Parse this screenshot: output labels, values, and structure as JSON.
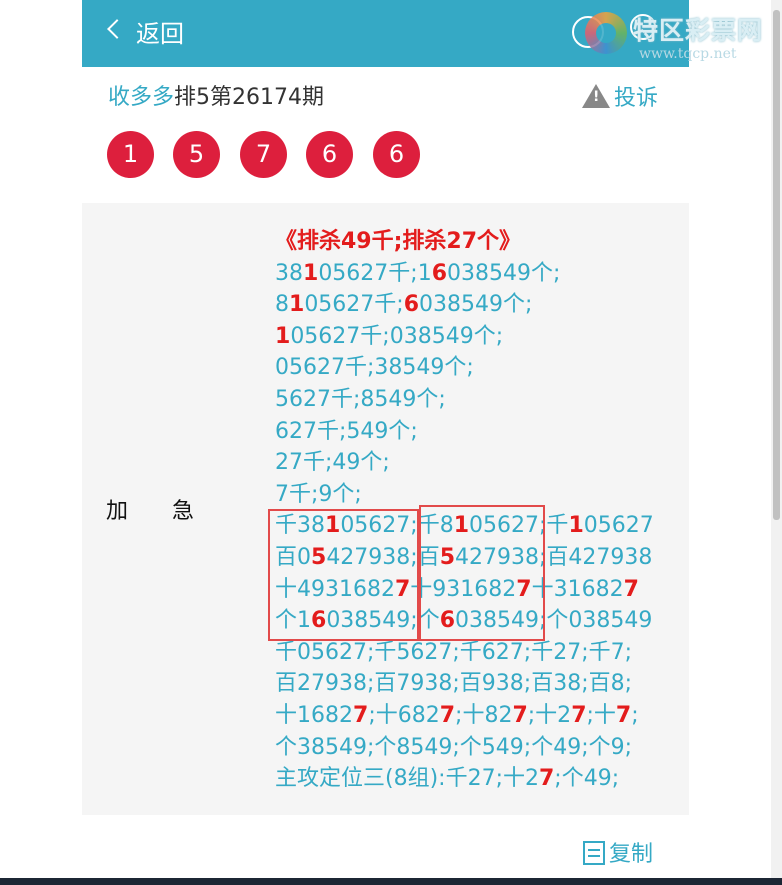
{
  "header": {
    "back_label": "返回",
    "watermark_title": "特区彩票网",
    "watermark_url": "www.tqcp.net",
    "background": "#35a9c5"
  },
  "issue": {
    "site_name": "收多多",
    "title": "排5第26174期",
    "complain_label": "投诉"
  },
  "numbers": [
    "1",
    "5",
    "7",
    "6",
    "6"
  ],
  "ball_color": "#dd1f3d",
  "panel": {
    "side_label": "加急",
    "heading": "《排杀49千;排杀27个》",
    "lines": [
      [
        [
          "38",
          0
        ],
        [
          "1",
          1
        ],
        [
          "05627千;1",
          0
        ],
        [
          "6",
          1
        ],
        [
          "038549个;",
          0
        ]
      ],
      [
        [
          "8",
          0
        ],
        [
          "1",
          1
        ],
        [
          "05627千;",
          0
        ],
        [
          "6",
          1
        ],
        [
          "038549个;",
          0
        ]
      ],
      [
        [
          "1",
          1
        ],
        [
          "05627千;038549个;",
          0
        ]
      ],
      [
        [
          "05627千;38549个;",
          0
        ]
      ],
      [
        [
          "5627千;8549个;",
          0
        ]
      ],
      [
        [
          "627千;549个;",
          0
        ]
      ],
      [
        [
          "27千;49个;",
          0
        ]
      ],
      [
        [
          "7千;9个;",
          0
        ]
      ],
      [
        [
          "千38",
          0
        ],
        [
          "1",
          1
        ],
        [
          "05627;千8",
          0
        ],
        [
          "1",
          1
        ],
        [
          "05627;千",
          0
        ],
        [
          "1",
          1
        ],
        [
          "05627",
          0
        ]
      ],
      [
        [
          "百0",
          0
        ],
        [
          "5",
          1
        ],
        [
          "427938;百",
          0
        ],
        [
          "5",
          1
        ],
        [
          "427938;百427938",
          0
        ]
      ],
      [
        [
          "十4931682",
          0
        ],
        [
          "7",
          1
        ],
        [
          "十931682",
          0
        ],
        [
          "7",
          1
        ],
        [
          "十31682",
          0
        ],
        [
          "7",
          1
        ]
      ],
      [
        [
          "个1",
          0
        ],
        [
          "6",
          1
        ],
        [
          "038549;个",
          0
        ],
        [
          "6",
          1
        ],
        [
          "038549;个038549",
          0
        ]
      ],
      [
        [
          "千05627;千5627;千627;千27;千7;",
          0
        ]
      ],
      [
        [
          "百27938;百7938;百938;百38;百8;",
          0
        ]
      ],
      [
        [
          "十1682",
          0
        ],
        [
          "7",
          1
        ],
        [
          ";十682",
          0
        ],
        [
          "7",
          1
        ],
        [
          ";十82",
          0
        ],
        [
          "7",
          1
        ],
        [
          ";十2",
          0
        ],
        [
          "7",
          1
        ],
        [
          ";十",
          0
        ],
        [
          "7",
          1
        ],
        [
          ";",
          0
        ]
      ],
      [
        [
          "个38549;个8549;个549;个49;个9;",
          0
        ]
      ],
      [
        [
          "主攻定位三(8组):千27;十2",
          0
        ],
        [
          "7",
          1
        ],
        [
          ";个49;",
          0
        ]
      ]
    ]
  },
  "copy_label": "复制"
}
